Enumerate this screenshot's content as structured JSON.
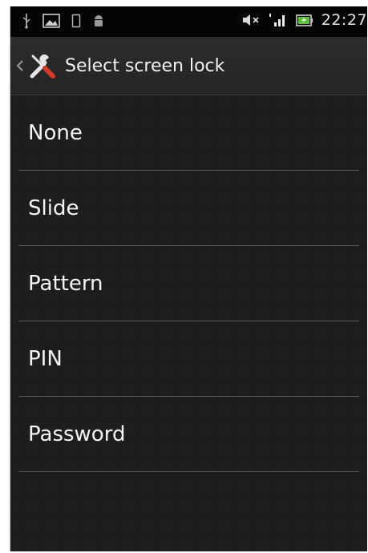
{
  "status_bar": {
    "time": "22:27",
    "left_icons": [
      "usb-icon",
      "image-icon",
      "phone-outline-icon",
      "android-icon"
    ],
    "right_icons": [
      "mute-icon",
      "signal-icon",
      "battery-icon"
    ]
  },
  "action_bar": {
    "title": "Select screen lock",
    "icon": "settings-tools-icon"
  },
  "lock_options": [
    {
      "label": "None"
    },
    {
      "label": "Slide"
    },
    {
      "label": "Pattern"
    },
    {
      "label": "PIN"
    },
    {
      "label": "Password"
    }
  ],
  "colors": {
    "background": "#1b1b1b",
    "status_bar": "#050505",
    "text": "#f5f5f5",
    "divider": "#5a5a5a"
  }
}
